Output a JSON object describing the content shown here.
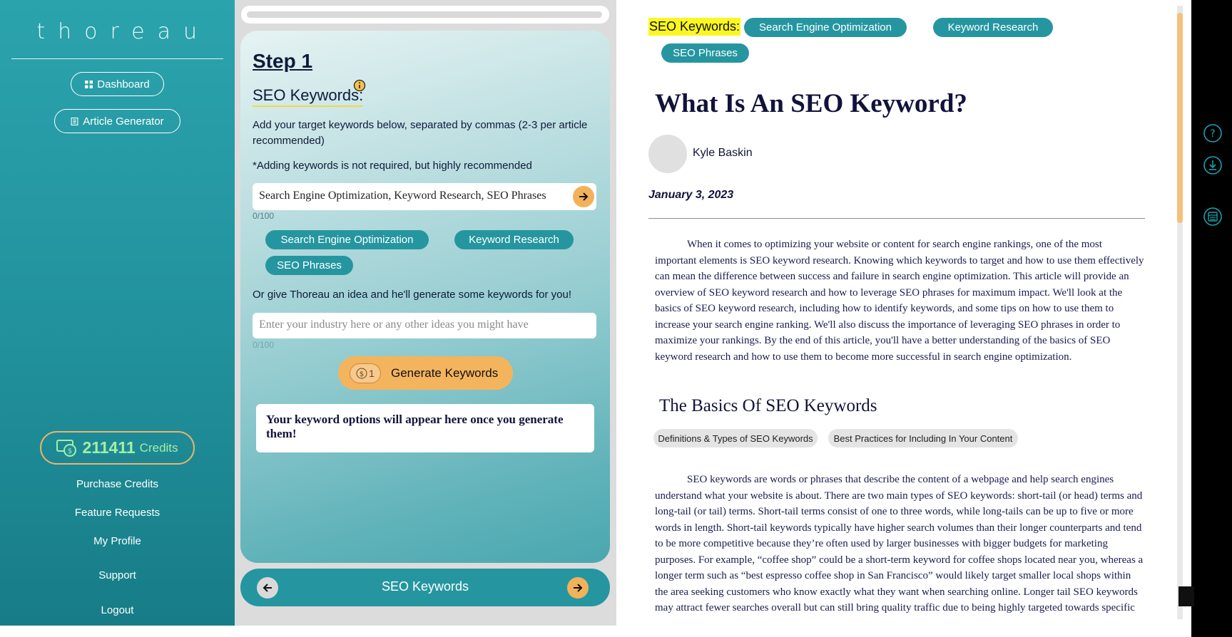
{
  "brand": {
    "name": "thoreau"
  },
  "sidebar": {
    "dashboard_label": "Dashboard",
    "article_generator_label": "Article Generator",
    "credits": {
      "amount": "211411",
      "label": "Credits"
    },
    "links": [
      "Purchase Credits",
      "Feature Requests",
      "My Profile",
      "Support",
      "Logout"
    ]
  },
  "step": {
    "title": "Step 1",
    "heading": "SEO Keywords:",
    "instructions": "Add your target keywords below, separated by commas (2-3 per article recommended)",
    "note": "*Adding keywords is not required, but highly recommended",
    "keywords_value": "Search Engine Optimization, Keyword Research, SEO Phrases",
    "keywords_counter": "0/100",
    "chips": [
      "Search Engine Optimization",
      "Keyword Research",
      "SEO Phrases"
    ],
    "idea_prompt": "Or give Thoreau an idea and he'll generate some keywords for you!",
    "idea_placeholder": "Enter your industry here or any other ideas you might have",
    "idea_counter": "0/100",
    "generate_cost": "1",
    "generate_label": "Generate Keywords",
    "options_placeholder": "Your keyword options will appear here once you generate them!"
  },
  "bottom_nav": {
    "label": "SEO Keywords"
  },
  "article": {
    "keywords_label": "SEO Keywords:",
    "keyword_chips": [
      "Search Engine Optimization",
      "Keyword Research",
      "SEO Phrases"
    ],
    "title": "What Is An SEO Keyword?",
    "author": "Kyle Baskin",
    "date": "January 3, 2023",
    "intro": "When it comes to optimizing your website or content for search engine rankings, one of the most important elements is SEO keyword research. Knowing which keywords to target and how to use them effectively can mean the difference between success and failure in search engine optimization. This article will provide an overview of SEO keyword research and how to leverage SEO phrases for maximum impact. We'll look at the basics of SEO keyword research, including how to identify keywords, and some tips on how to use them to increase your search engine ranking. We'll also discuss the importance of leveraging SEO phrases in order to maximize your rankings. By the end of this article, you'll have a better understanding of the basics of SEO keyword research and how to use them to become more successful in search engine optimization.",
    "section_title": "The Basics Of SEO Keywords",
    "section_chips": [
      "Definitions & Types of SEO Keywords",
      "Best Practices for Including In Your Content"
    ],
    "section_para": "SEO keywords are words or phrases that describe the content of a webpage and help search engines understand what your website is about. There are two main types of SEO keywords: short-tail (or head) terms and long-tail (or tail) terms. Short-tail terms consist of one to three words, while long-tails can be up to five or more words in length. Short-tail keywords typically have higher search volumes than their longer counterparts and tend to be more competitive because they’re often used by larger businesses with bigger budgets for marketing purposes. For example, “coffee shop” could be a short-term keyword for coffee shops located near you, whereas a longer term such as “best espresso coffee shop in San Francisco” would likely target smaller local shops within the area seeking customers who know exactly what they want when searching online. Longer tail SEO keywords may attract fewer searches overall but can still bring quality traffic due to being highly targeted towards specific topics or products"
  },
  "colors": {
    "teal": "#2596a0",
    "accent_orange": "#f4b45e",
    "credits_green": "#a6eea4",
    "navy_text": "#12133a"
  },
  "icons": [
    "logo-network-icon",
    "dashboard-icon",
    "document-icon",
    "info-icon",
    "arrow-right-icon",
    "coin-icon",
    "credits-icon",
    "arrow-left-icon",
    "help-icon",
    "download-icon",
    "list-icon"
  ]
}
